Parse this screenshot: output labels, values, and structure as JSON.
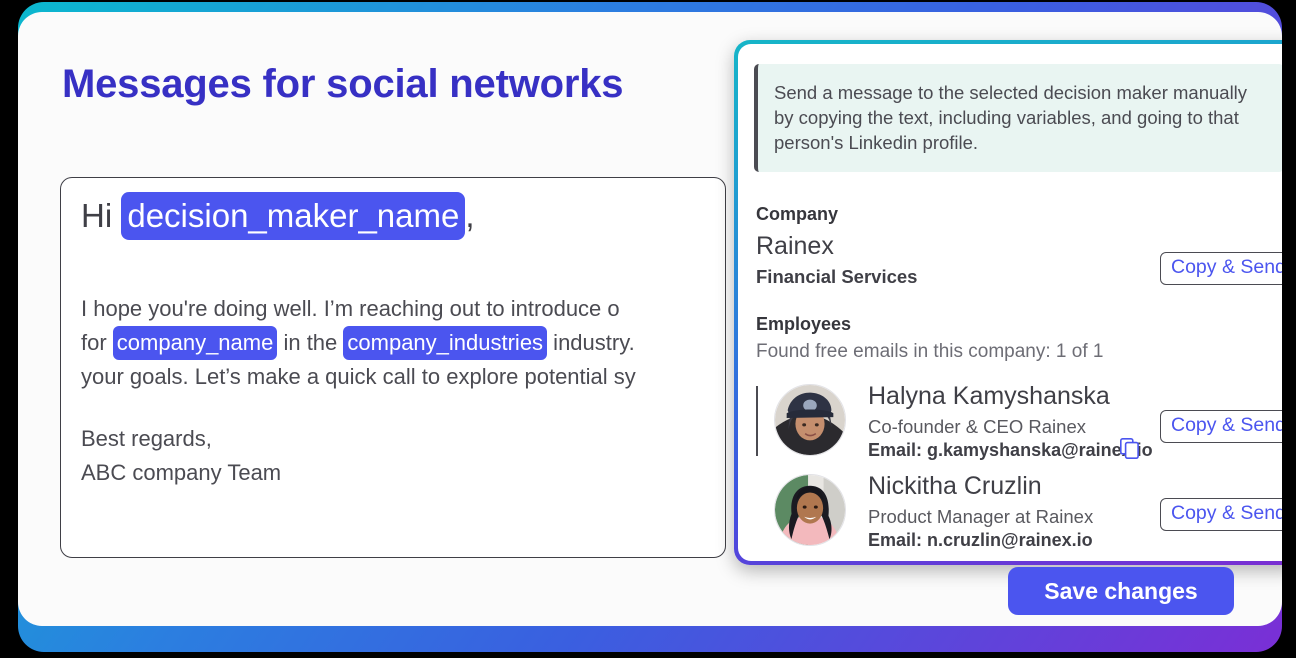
{
  "page": {
    "title": "Messages for social networks",
    "accent_color": "#3730c4",
    "frame_gradient": [
      "#0bb8ce",
      "#2b7fe0",
      "#3a5fe0",
      "#7a2fd6"
    ]
  },
  "message": {
    "greeting_prefix": "Hi ",
    "greeting_variable": "decision_maker_name",
    "greeting_suffix": ",",
    "paragraph": {
      "line1": "I hope you're doing well. I’m reaching out to introduce o",
      "line2_prefix": "for ",
      "line2_var1": "company_name",
      "line2_mid": " in the ",
      "line2_var2": "company_industries",
      "line2_suffix": " industry.",
      "line3": "your goals. Let’s make a quick call to explore potential sy"
    },
    "signoff_line1": "Best regards,",
    "signoff_line2": "ABC company Team",
    "variable_color": "#4b55ef"
  },
  "panel": {
    "note": "Send a message to the selected decision maker manually by copying the text, including variables, and going to that person's Linkedin profile.",
    "company_label": "Company",
    "company_name": "Rainex",
    "company_industry": "Financial Services",
    "company_copy_send_label": "Copy & Send",
    "employees_label": "Employees",
    "employees_found": "Found free emails in this company: 1 of 1",
    "employees": [
      {
        "name": "Halyna Kamyshanska",
        "role": "Co-founder & CEO Rainex",
        "email": "Email: g.kamyshanska@rainex.io",
        "has_copy_icon": true,
        "copy_send_label": "Copy & Send"
      },
      {
        "name": "Nickitha Cruzlin",
        "role": "Product Manager at Rainex",
        "email": "Email: n.cruzlin@rainex.io",
        "has_copy_icon": false,
        "copy_send_label": "Copy & Send"
      }
    ],
    "border_gradient": [
      "#16b5c8",
      "#2f73dd",
      "#7b2ed2"
    ]
  },
  "footer": {
    "save_label": "Save changes",
    "save_color": "#4b55ef"
  }
}
